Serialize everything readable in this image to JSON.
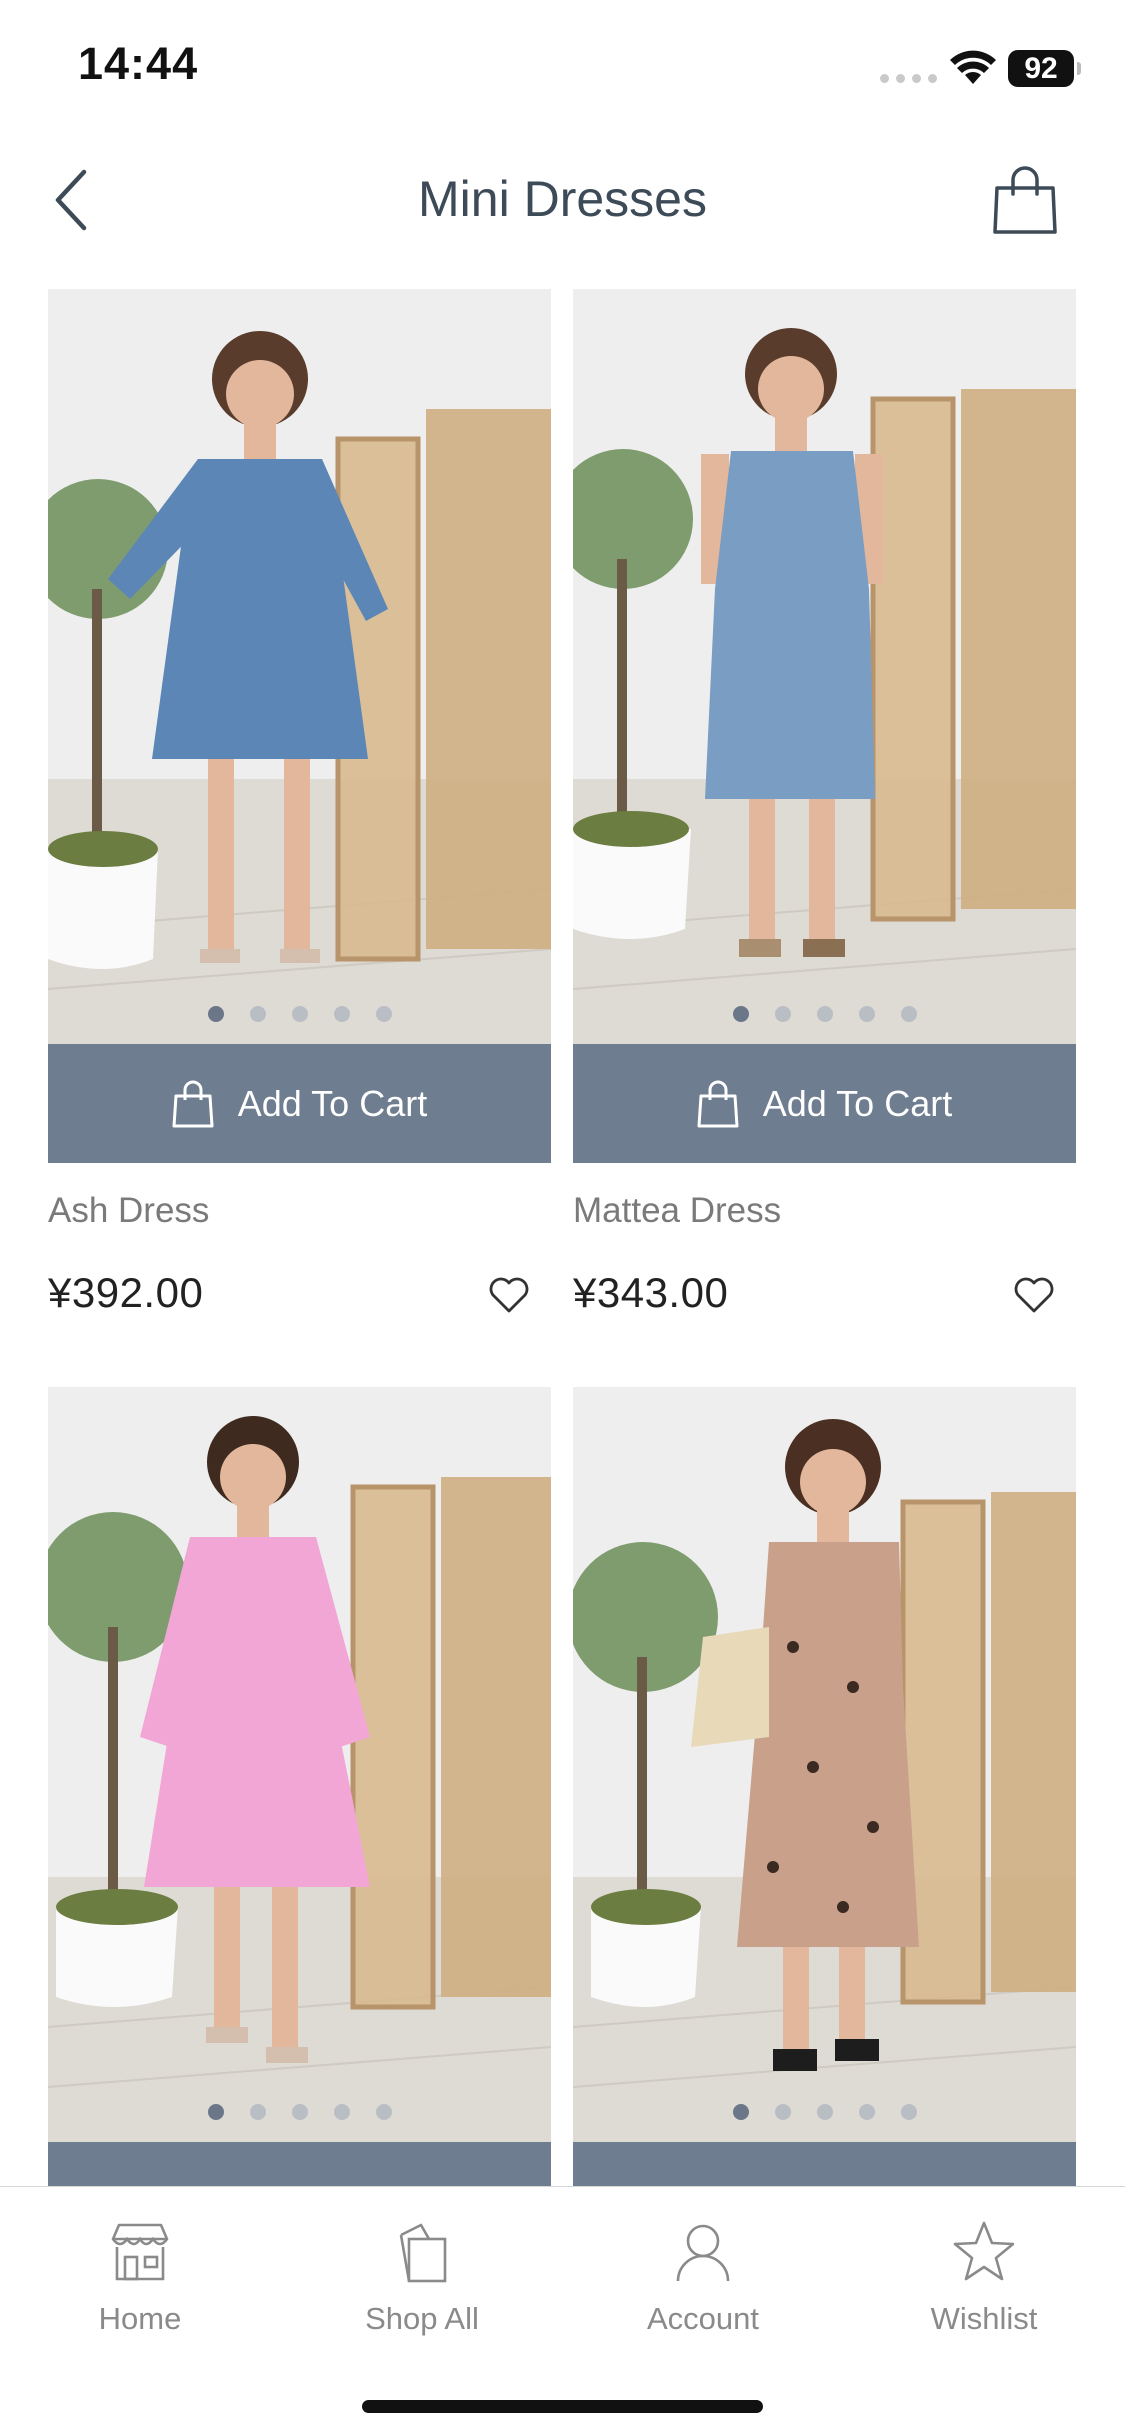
{
  "status_bar": {
    "time": "14:44",
    "battery": "92"
  },
  "header": {
    "title": "Mini Dresses"
  },
  "products": [
    {
      "name": "Ash Dress",
      "price": "¥392.00",
      "cart_label": "Add To Cart",
      "dress_color": "#5b86b6",
      "image_count": 5,
      "active_image": 0
    },
    {
      "name": "Mattea Dress",
      "price": "¥343.00",
      "cart_label": "Add To Cart",
      "dress_color": "#7a9dc4",
      "image_count": 5,
      "active_image": 0
    },
    {
      "name": "",
      "price": "",
      "cart_label": "",
      "dress_color": "#f2a6d6",
      "image_count": 5,
      "active_image": 0
    },
    {
      "name": "",
      "price": "",
      "cart_label": "",
      "dress_color": "#c9a08a",
      "image_count": 5,
      "active_image": 0
    }
  ],
  "tabbar": {
    "items": [
      {
        "label": "Home",
        "icon": "store-icon"
      },
      {
        "label": "Shop All",
        "icon": "shopping-bag-icon"
      },
      {
        "label": "Account",
        "icon": "user-icon"
      },
      {
        "label": "Wishlist",
        "icon": "star-icon"
      }
    ]
  },
  "colors": {
    "accent": "#6e7d8f",
    "title": "#3d4a57"
  }
}
